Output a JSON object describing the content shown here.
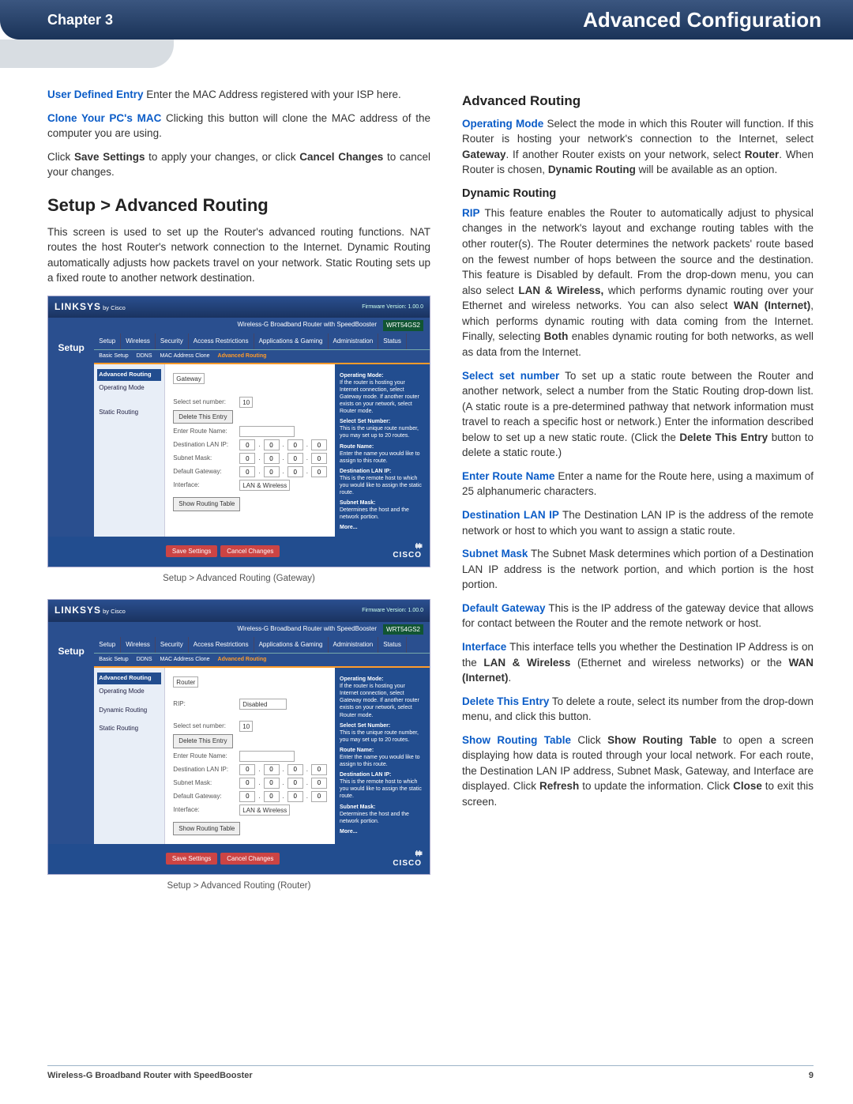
{
  "header": {
    "chapter": "Chapter 3",
    "title": "Advanced Configuration"
  },
  "left": {
    "p1_label": "User Defined Entry",
    "p1_text": " Enter the MAC Address registered with your ISP here.",
    "p2_label": "Clone Your PC's MAC",
    "p2_text": "  Clicking this button will clone the MAC address of the computer you are using.",
    "p3_a": "Click ",
    "p3_b": "Save Settings",
    "p3_c": " to apply your changes, or click ",
    "p3_d": "Cancel Changes",
    "p3_e": " to cancel your changes.",
    "h2": "Setup > Advanced Routing",
    "intro": "This screen is used to set up the Router's advanced routing functions. NAT routes the host Router's network connection to the Internet. Dynamic Routing automatically adjusts how packets travel on your network. Static Routing sets up a fixed route to another network destination.",
    "cap1": "Setup > Advanced Routing (Gateway)",
    "cap2": "Setup > Advanced Routing (Router)"
  },
  "right": {
    "h3": "Advanced Routing",
    "op_label": "Operating Mode",
    "op_a": "  Select the mode in which this Router will function. If this Router is hosting your network's connection to the Internet, select ",
    "op_b": "Gateway",
    "op_c": ". If another Router exists on your network, select ",
    "op_d": "Router",
    "op_e": ". When Router is chosen, ",
    "op_f": "Dynamic Routing",
    "op_g": " will be available as an option.",
    "h4": "Dynamic Routing",
    "rip_label": "RIP",
    "rip_a": " This feature enables the Router to automatically adjust to physical changes in the network's layout and exchange routing tables with the other router(s). The Router determines the network packets' route based on the fewest number of hops between the source and the destination. This feature is Disabled by default. From the drop-down menu, you can also select ",
    "rip_b": "LAN & Wireless,",
    "rip_c": " which performs dynamic routing over your Ethernet and wireless networks. You can also select ",
    "rip_d": "WAN (Internet)",
    "rip_e": ", which performs dynamic routing with data coming from the Internet. Finally, selecting ",
    "rip_f": "Both",
    "rip_g": " enables dynamic routing for both networks, as well as data from the Internet.",
    "sel_label": "Select set number",
    "sel_a": "  To set up a static route between the Router and another network, select a number from the Static Routing drop-down list. (A static route is a pre-determined pathway that network information must travel to reach a specific host or network.) Enter the information described below to set up a new static route. (Click the ",
    "sel_b": "Delete This Entry",
    "sel_c": " button to delete a static route.)",
    "ern_label": "Enter Route Name",
    "ern_text": " Enter a name for the Route here, using a maximum of 25 alphanumeric characters.",
    "dli_label": "Destination LAN IP",
    "dli_text": "  The Destination LAN IP is the address of the remote network or host to which you want to assign a static route.",
    "sm_label": "Subnet Mask",
    "sm_text": " The Subnet Mask determines which portion of a Destination LAN IP address is the network portion, and which portion is the host portion.",
    "dg_label": "Default Gateway",
    "dg_text": "  This is the IP address of the gateway device that allows for contact between the Router and the remote network or host.",
    "if_label": "Interface",
    "if_a": "  This interface tells you whether the Destination IP Address is on the ",
    "if_b": "LAN & Wireless",
    "if_c": " (Ethernet and wireless networks) or the ",
    "if_d": "WAN (Internet)",
    "if_e": ".",
    "dte_label": "Delete This Entry",
    "dte_text": "  To delete a route, select its number from the drop-down menu, and click this button.",
    "srt_label": "Show Routing Table",
    "srt_a": "  Click ",
    "srt_b": "Show Routing Table",
    "srt_c": " to open a screen displaying how data is routed through your local network. For each route, the Destination LAN IP address, Subnet Mask, Gateway, and Interface are displayed. Click ",
    "srt_d": "Refresh",
    "srt_e": " to update the information. Click ",
    "srt_f": "Close",
    "srt_g": " to exit this screen."
  },
  "shot": {
    "logo": "LINKSYS",
    "logo_sub": " by Cisco",
    "fw": "Firmware Version: 1.00.0",
    "model_row": "Wireless-G Broadband Router with SpeedBooster",
    "model": "WRT54GS2",
    "setup": "Setup",
    "tabs": [
      "Setup",
      "Wireless",
      "Security",
      "Access Restrictions",
      "Applications & Gaming",
      "Administration",
      "Status"
    ],
    "subtabs": [
      "Basic Setup",
      "DDNS",
      "MAC Address Clone",
      "Advanced Routing"
    ],
    "side": {
      "hl": "Advanced Routing",
      "a": "Operating Mode",
      "b": "Dynamic Routing",
      "c": "Static Routing"
    },
    "form": {
      "opmode_gw": "Gateway",
      "opmode_rt": "Router",
      "rip": "RIP:",
      "rip_val": "Disabled",
      "selnum": "Select set number:",
      "selnum_val": "10",
      "delbtn": "Delete This Entry",
      "routename": "Enter Route Name:",
      "dest": "Destination LAN IP:",
      "sub": "Subnet Mask:",
      "gw": "Default Gateway:",
      "iface": "Interface:",
      "iface_val": "LAN & Wireless",
      "showbtn": "Show Routing Table"
    },
    "help": {
      "a": "Operating Mode:",
      "at": "If the router is hosting your Internet connection, select Gateway mode. If another router exists on your network, select Router mode.",
      "b": "Select Set Number:",
      "bt": "This is the unique route number, you may set up to 20 routes.",
      "c": "Route Name:",
      "ct": "Enter the name you would like to assign to this route.",
      "d": "Destination LAN IP:",
      "dt": "This is the remote host to which you would like to assign the static route.",
      "e": "Subnet Mask:",
      "et": "Determines the host and the network portion.",
      "more": "More..."
    },
    "save": "Save Settings",
    "cancel": "Cancel Changes",
    "cisco": "CISCO"
  },
  "footer": {
    "left": "Wireless-G Broadband Router with SpeedBooster",
    "page": "9"
  }
}
